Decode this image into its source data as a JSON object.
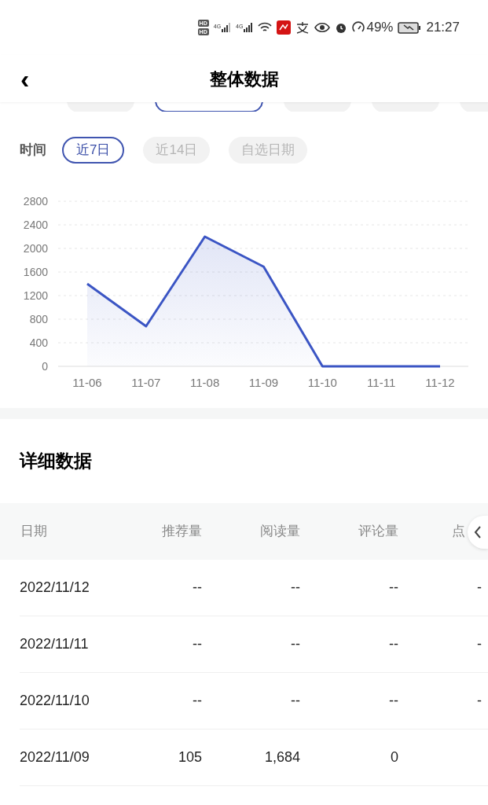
{
  "status_bar": {
    "sim_labels": [
      "HD",
      "HD"
    ],
    "network_labels": [
      "4G",
      "4G"
    ],
    "battery_percent": "49%",
    "time": "21:27"
  },
  "header": {
    "back": "‹",
    "title": "整体数据"
  },
  "metric_chips": [
    {
      "selected": false
    },
    {
      "selected": true
    },
    {
      "selected": false
    },
    {
      "selected": false
    },
    {
      "selected": false
    }
  ],
  "time_filter": {
    "label": "时间",
    "options": [
      {
        "label": "近7日",
        "selected": true
      },
      {
        "label": "近14日",
        "selected": false
      },
      {
        "label": "自选日期",
        "selected": false
      }
    ]
  },
  "chart_data": {
    "type": "area",
    "grid": true,
    "categories": [
      "11-06",
      "11-07",
      "11-08",
      "11-09",
      "11-10",
      "11-11",
      "11-12"
    ],
    "series": [
      {
        "color": "#3b55c4",
        "values": [
          1400,
          680,
          2200,
          1690,
          0,
          0,
          0
        ]
      }
    ],
    "ylim": [
      0,
      2800
    ],
    "yticks": [
      0,
      400,
      800,
      1200,
      1600,
      2000,
      2400,
      2800
    ]
  },
  "details": {
    "title": "详细数据",
    "columns": [
      "日期",
      "推荐量",
      "阅读量",
      "评论量",
      "点"
    ],
    "rows": [
      {
        "cells": [
          "2022/11/12",
          "--",
          "--",
          "--",
          "-"
        ]
      },
      {
        "cells": [
          "2022/11/11",
          "--",
          "--",
          "--",
          "-"
        ]
      },
      {
        "cells": [
          "2022/11/10",
          "--",
          "--",
          "--",
          "-"
        ]
      },
      {
        "cells": [
          "2022/11/09",
          "105",
          "1,684",
          "0"
        ]
      }
    ]
  }
}
